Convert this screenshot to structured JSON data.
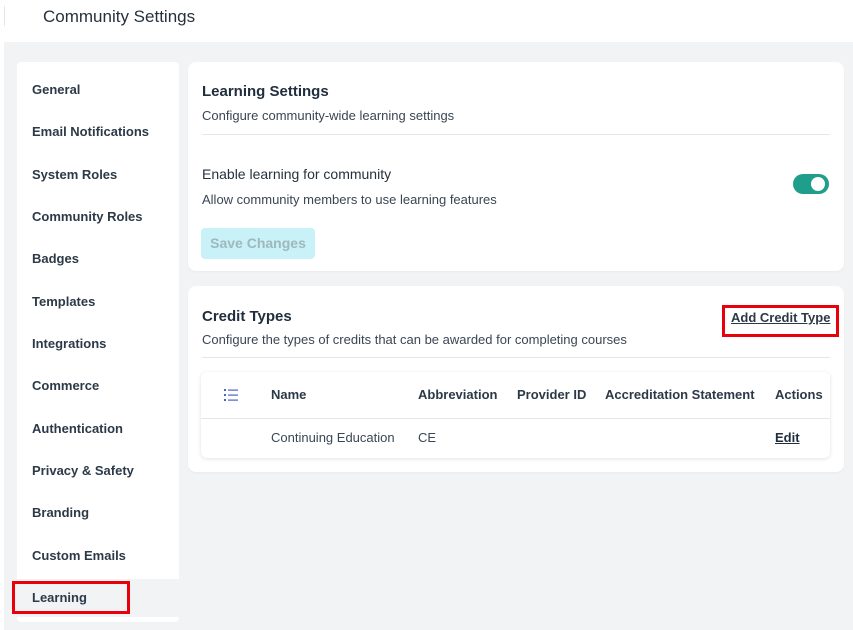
{
  "page": {
    "title": "Community Settings"
  },
  "sidebar": {
    "items": [
      {
        "label": "General",
        "active": false
      },
      {
        "label": "Email Notifications",
        "active": false
      },
      {
        "label": "System Roles",
        "active": false
      },
      {
        "label": "Community Roles",
        "active": false
      },
      {
        "label": "Badges",
        "active": false
      },
      {
        "label": "Templates",
        "active": false
      },
      {
        "label": "Integrations",
        "active": false
      },
      {
        "label": "Commerce",
        "active": false
      },
      {
        "label": "Authentication",
        "active": false
      },
      {
        "label": "Privacy & Safety",
        "active": false
      },
      {
        "label": "Branding",
        "active": false
      },
      {
        "label": "Custom Emails",
        "active": false
      },
      {
        "label": "Learning",
        "active": true
      }
    ]
  },
  "learning_settings": {
    "title": "Learning Settings",
    "subtitle": "Configure community-wide learning settings",
    "enable_label": "Enable learning for community",
    "enable_help": "Allow community members to use learning features",
    "enabled": true,
    "save_label": "Save Changes"
  },
  "credit_types": {
    "title": "Credit Types",
    "subtitle": "Configure the types of credits that can be awarded for completing courses",
    "add_label": "Add Credit Type",
    "columns": [
      "Name",
      "Abbreviation",
      "Provider ID",
      "Accreditation Statement",
      "Actions"
    ],
    "rows": [
      {
        "name": "Continuing Education",
        "abbreviation": "CE",
        "provider_id": "",
        "accreditation_statement": "",
        "action": "Edit"
      }
    ]
  },
  "colors": {
    "accent": "#1f9e8c",
    "highlight": "#e8000b",
    "background": "#f2f3f5"
  },
  "icons": {
    "list_icon": "list-icon"
  }
}
